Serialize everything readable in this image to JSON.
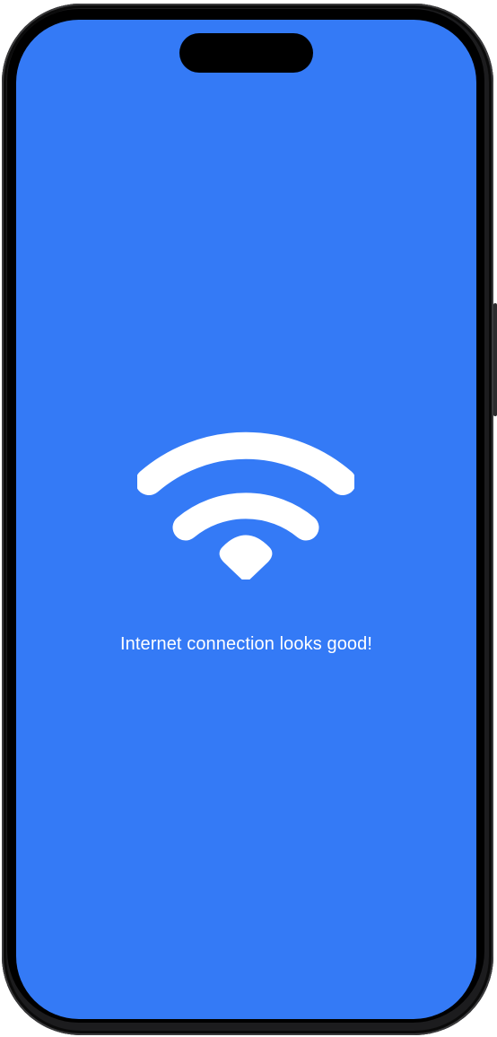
{
  "colors": {
    "screen_background": "#347AF6",
    "foreground": "#FFFFFF",
    "device_frame": "#1C1C1E"
  },
  "status": {
    "icon": "wifi-icon",
    "message": "Internet connection looks good!"
  }
}
